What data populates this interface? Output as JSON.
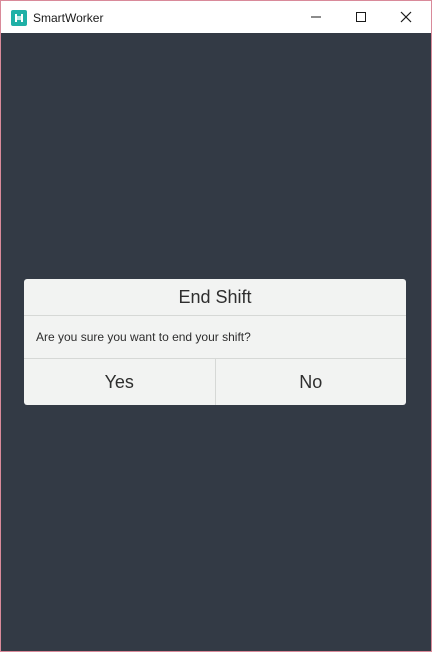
{
  "window": {
    "title": "SmartWorker",
    "icon": "smartworker-app-icon",
    "controls": [
      "minimize-icon",
      "maximize-icon",
      "close-icon"
    ]
  },
  "dialog": {
    "title": "End Shift",
    "message": "Are you sure you want to end your shift?",
    "yes_label": "Yes",
    "no_label": "No"
  },
  "colors": {
    "background": "#333a45",
    "dialog": "#f2f3f2",
    "accent": "#1fb0a6",
    "window_border": "#d98a9a"
  }
}
